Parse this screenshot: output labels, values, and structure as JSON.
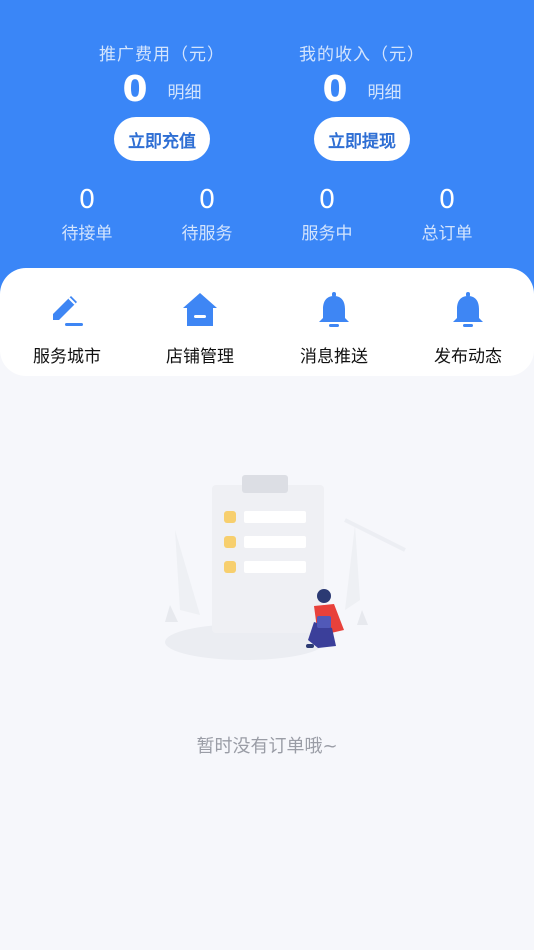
{
  "balances": [
    {
      "title": "推广费用（元）",
      "amount": "0",
      "detail": "明细",
      "button": "立即充值"
    },
    {
      "title": "我的收入（元）",
      "amount": "0",
      "detail": "明细",
      "button": "立即提现"
    }
  ],
  "stats": [
    {
      "value": "0",
      "label": "待接单"
    },
    {
      "value": "0",
      "label": "待服务"
    },
    {
      "value": "0",
      "label": "服务中"
    },
    {
      "value": "0",
      "label": "总订单"
    }
  ],
  "quick_actions": [
    {
      "label": "服务城市",
      "icon": "pencil-edit-icon"
    },
    {
      "label": "店铺管理",
      "icon": "house-store-icon"
    },
    {
      "label": "消息推送",
      "icon": "bell-icon"
    },
    {
      "label": "发布动态",
      "icon": "bell-icon"
    }
  ],
  "empty_state": {
    "message": "暂时没有订单哦~",
    "illustration": "empty-clipboard-person-illustration"
  },
  "colors": {
    "primary": "#3a86f7",
    "button_text": "#2f6fd4",
    "icon_blue": "#3e86f4",
    "background": "#f6f7fb"
  }
}
